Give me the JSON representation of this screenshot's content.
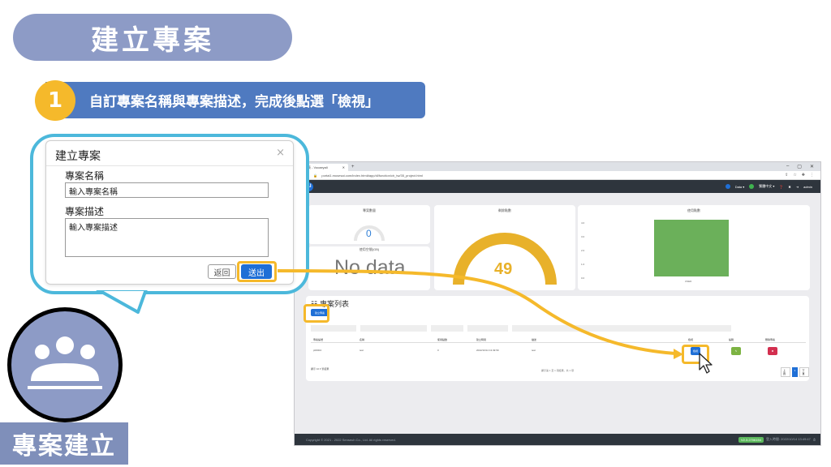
{
  "slide": {
    "title": "建立專案",
    "step_number": "1",
    "step_text": "自訂專案名稱與專案描述，完成後點選「檢視」"
  },
  "browser": {
    "tab_title": "專案列表 - Vocaeyali",
    "address": "portal1.musesai.com/index.html#app/dl/function/ch_tw/35_project.html",
    "app_logo": "AI",
    "app_menu": [
      "Data ▾",
      "繁體中文 ▾",
      "admin"
    ],
    "cards": {
      "project_count_title": "專案數量",
      "project_count_value": "0",
      "usage_title": "使用空間(GB)",
      "no_data": "No data",
      "gauge_title": "剩餘點數",
      "gauge_value": "49",
      "chart_title": "使用點數",
      "chart_axis": [
        "4.0",
        "3.0",
        "2.0",
        "1.0",
        "0.0"
      ],
      "chart_bar_label": "USED"
    },
    "section_title": "專案列表",
    "new_button": "建立專案",
    "table": {
      "headers": [
        "專案編號",
        "名稱",
        "使用點數",
        "建立時間",
        "描述",
        "檢視",
        "編輯",
        "刪除專案"
      ],
      "row": [
        "p00004",
        "test",
        "0",
        "2022/10/14 13:49:59",
        "test"
      ],
      "view_label": "檢視",
      "edit_label": "✎",
      "delete_label": "✖"
    },
    "pager_left": "顯示 10 ▾ 筆結果",
    "pager_mid": "顯示第 1 至 1 項結果，共 1 項",
    "pager_buttons": [
      "上頁",
      "1",
      "下頁"
    ],
    "footer_left": "Copyright © 2021 - 2022 Senseuh Co., Ltd. All rights reserved.",
    "footer_version": "V2.3.2706154",
    "footer_right": "登入時間: 2022/10/14 13:49:47"
  },
  "dialog": {
    "title": "建立專案",
    "close": "×",
    "name_label": "專案名稱",
    "name_value": "輸入專案名稱",
    "desc_label": "專案描述",
    "desc_value": "輸入專案描述",
    "back_button": "返回",
    "submit_button": "送出"
  },
  "icon_label": "專案建立",
  "colors": {
    "accent_blue": "#1f6fd6",
    "highlight": "#f5b92b",
    "title_bg": "#8d9bc6",
    "step_bg": "#4f7ac0",
    "callout_border": "#4cb8db"
  }
}
